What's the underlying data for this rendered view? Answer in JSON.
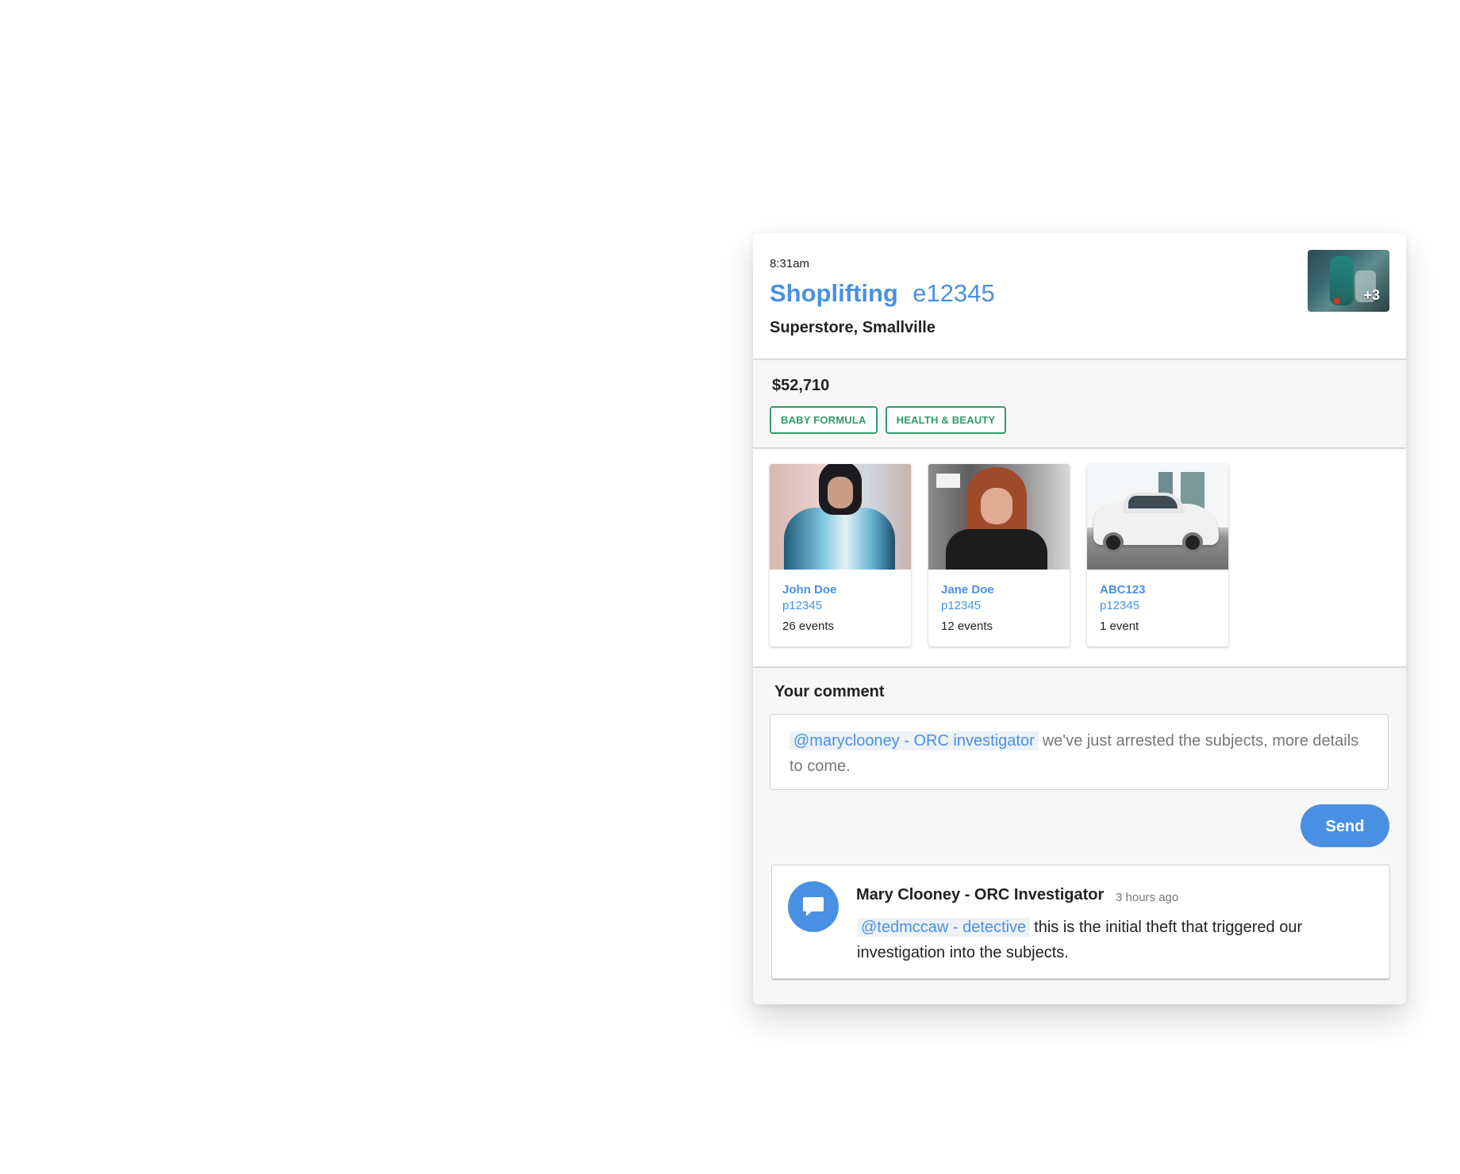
{
  "incident": {
    "time": "8:31am",
    "type": "Shoplifting",
    "id": "e12345",
    "location": "Superstore, Smallville",
    "media_count": "+3"
  },
  "summary": {
    "amount": "$52,710",
    "tags": [
      "BABY FORMULA",
      "HEALTH & BEAUTY"
    ]
  },
  "entities": [
    {
      "name": "John Doe",
      "id": "p12345",
      "events": "26 events"
    },
    {
      "name": "Jane Doe",
      "id": "p12345",
      "events": "12 events"
    },
    {
      "name": "ABC123",
      "id": "p12345",
      "events": "1 event"
    }
  ],
  "comment_form": {
    "label": "Your comment",
    "mention": "@maryclooney - ORC investigator",
    "text": "we've just arrested the subjects, more details to come.",
    "send_label": "Send"
  },
  "comments": [
    {
      "author": "Mary Clooney - ORC Investigator",
      "time_ago": "3 hours ago",
      "mention": "@tedmccaw - detective",
      "text": "this is the initial theft that triggered our investigation into the subjects.",
      "icon": "comment-icon"
    }
  ],
  "colors": {
    "accent": "#4a90e2",
    "tag": "#2e9b6a"
  }
}
